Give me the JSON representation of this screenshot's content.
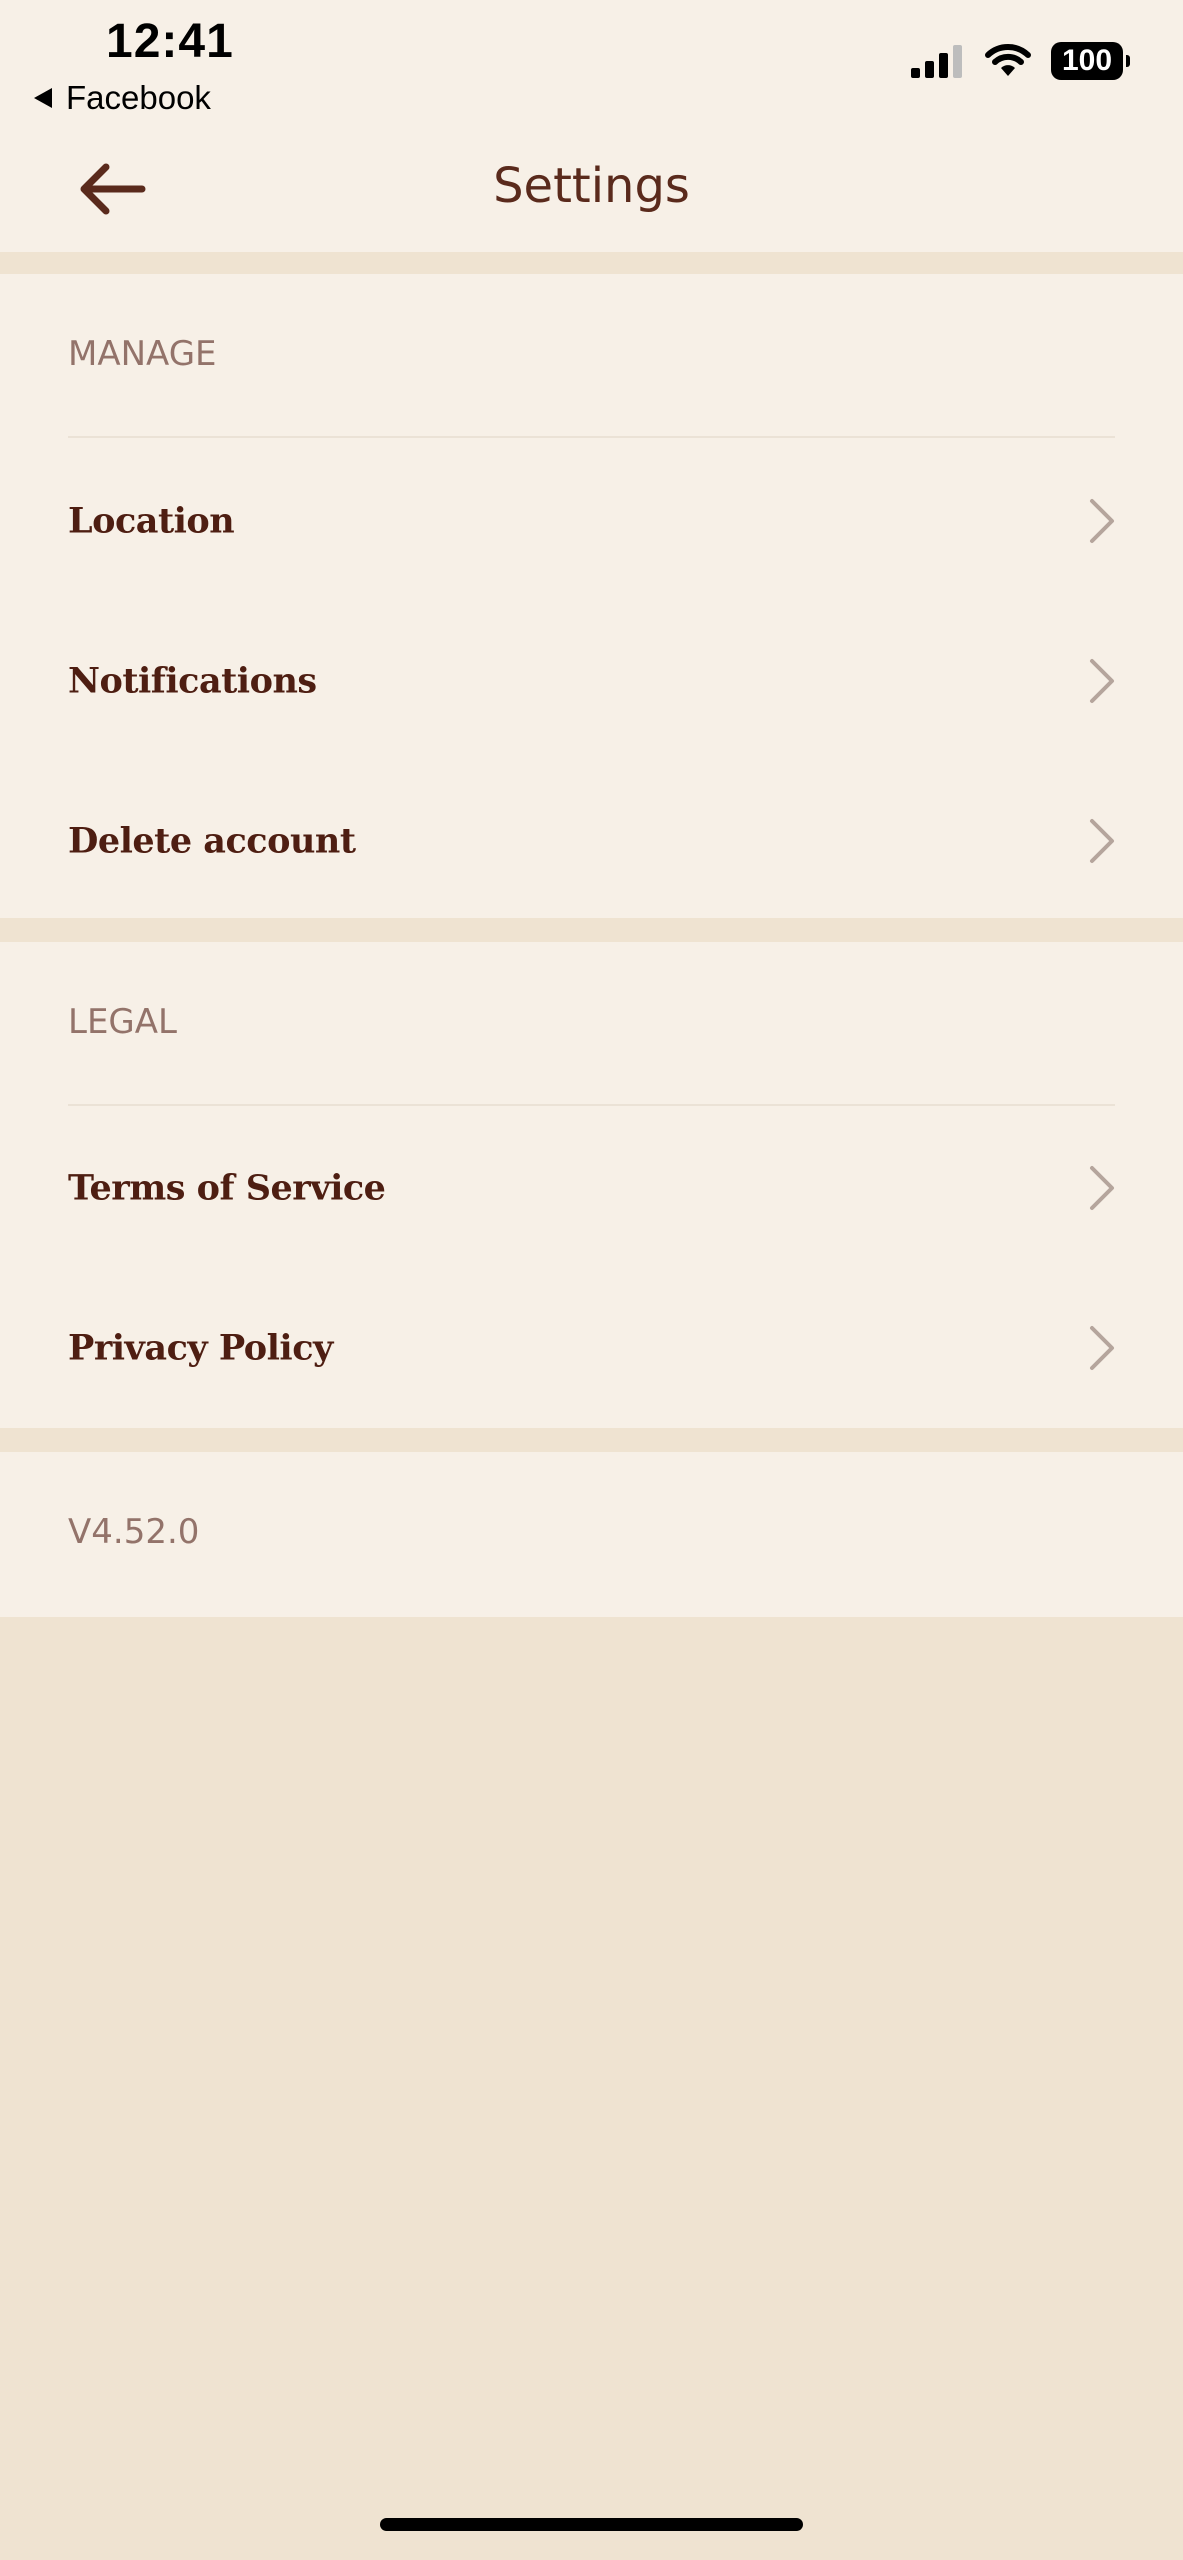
{
  "status_bar": {
    "time": "12:41",
    "back_app": "Facebook",
    "battery": "100",
    "icons": [
      "signal-icon",
      "wifi-icon",
      "battery-icon"
    ]
  },
  "nav": {
    "title": "Settings",
    "back_icon": "arrow-left-icon"
  },
  "manage": {
    "header": "MANAGE",
    "items": [
      {
        "label": "Location"
      },
      {
        "label": "Notifications"
      },
      {
        "label": "Delete account"
      }
    ]
  },
  "legal": {
    "header": "LEGAL",
    "items": [
      {
        "label": "Terms of Service"
      },
      {
        "label": "Privacy Policy"
      }
    ]
  },
  "version": "V4.52.0",
  "colors": {
    "background": "#efe3d1",
    "surface": "#f7f0e7",
    "primary_text": "#4e1e12",
    "secondary_text": "#93736a",
    "chevron": "#b5a59c"
  }
}
